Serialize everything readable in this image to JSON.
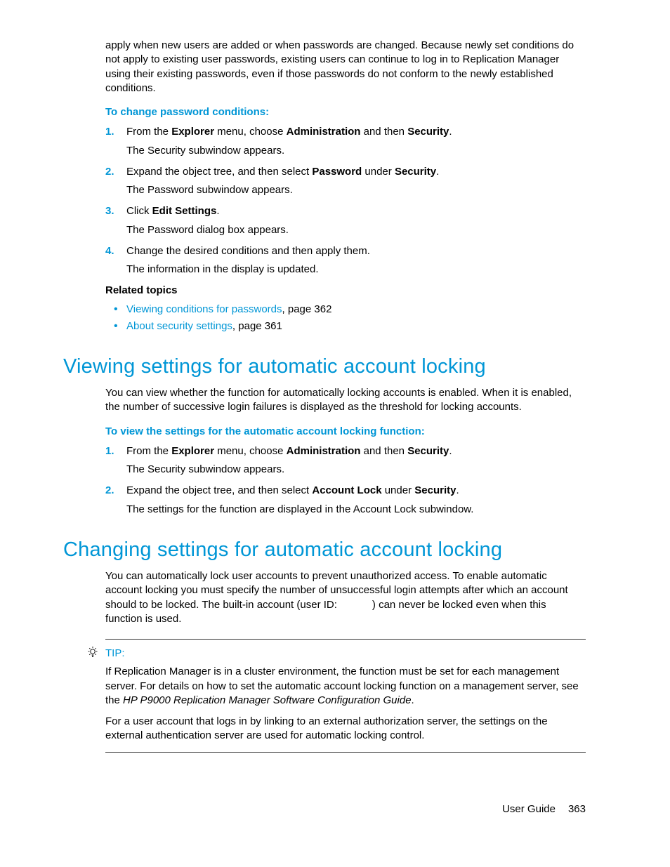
{
  "intro": {
    "paragraph": "apply when new users are added or when passwords are changed. Because newly set conditions do not apply to existing user passwords, existing users can continue to log in to Replication Manager using their existing passwords, even if those passwords do not conform to the newly established conditions."
  },
  "changePassword": {
    "heading": "To change password conditions:",
    "steps": [
      {
        "num": "1.",
        "pre": "From the ",
        "b1": "Explorer",
        "mid1": " menu, choose ",
        "b2": "Administration",
        "mid2": " and then ",
        "b3": "Security",
        "post": ".",
        "result": "The Security subwindow appears."
      },
      {
        "num": "2.",
        "pre": "Expand the object tree, and then select ",
        "b1": "Password",
        "mid1": " under ",
        "b2": "Security",
        "post": ".",
        "result": "The Password subwindow appears."
      },
      {
        "num": "3.",
        "pre": "Click ",
        "b1": "Edit Settings",
        "post": ".",
        "result": "The Password dialog box appears."
      },
      {
        "num": "4.",
        "pre": "Change the desired conditions and then apply them.",
        "result": "The information in the display is updated."
      }
    ]
  },
  "relatedTopics": {
    "heading": "Related topics",
    "items": [
      {
        "link": "Viewing conditions for passwords",
        "suffix": ", page 362"
      },
      {
        "link": "About security settings",
        "suffix": ", page 361"
      }
    ]
  },
  "viewingSection": {
    "heading": "Viewing settings for automatic account locking",
    "intro": "You can view whether the function for automatically locking accounts is enabled. When it is enabled, the number of successive login failures is displayed as the threshold for locking accounts.",
    "subhead": "To view the settings for the automatic account locking function:",
    "steps": [
      {
        "num": "1.",
        "pre": "From the ",
        "b1": "Explorer",
        "mid1": " menu, choose ",
        "b2": "Administration",
        "mid2": " and then ",
        "b3": "Security",
        "post": ".",
        "result": "The Security subwindow appears."
      },
      {
        "num": "2.",
        "pre": "Expand the object tree, and then select ",
        "b1": "Account Lock",
        "mid1": " under ",
        "b2": "Security",
        "post": ".",
        "result": "The settings for the function are displayed in the Account Lock subwindow."
      }
    ]
  },
  "changingSection": {
    "heading": "Changing settings for automatic account locking",
    "intro_pre": "You can automatically lock user accounts to prevent unauthorized access. To enable automatic account locking you must specify the number of unsuccessful login attempts after which an account should to be locked. The built-in account (user ID: ",
    "intro_post": ") can never be locked even when this function is used."
  },
  "tip": {
    "label": "TIP:",
    "p1_pre": "If Replication Manager is in a cluster environment, the function must be set for each management server. For details on how to set the automatic account locking function on a management server, see the ",
    "p1_ital": "HP P9000 Replication Manager Software Configuration Guide",
    "p1_post": ".",
    "p2": "For a user account that logs in by linking to an external authorization server, the settings on the external authentication server are used for automatic locking control."
  },
  "footer": {
    "label": "User Guide",
    "page": "363"
  }
}
